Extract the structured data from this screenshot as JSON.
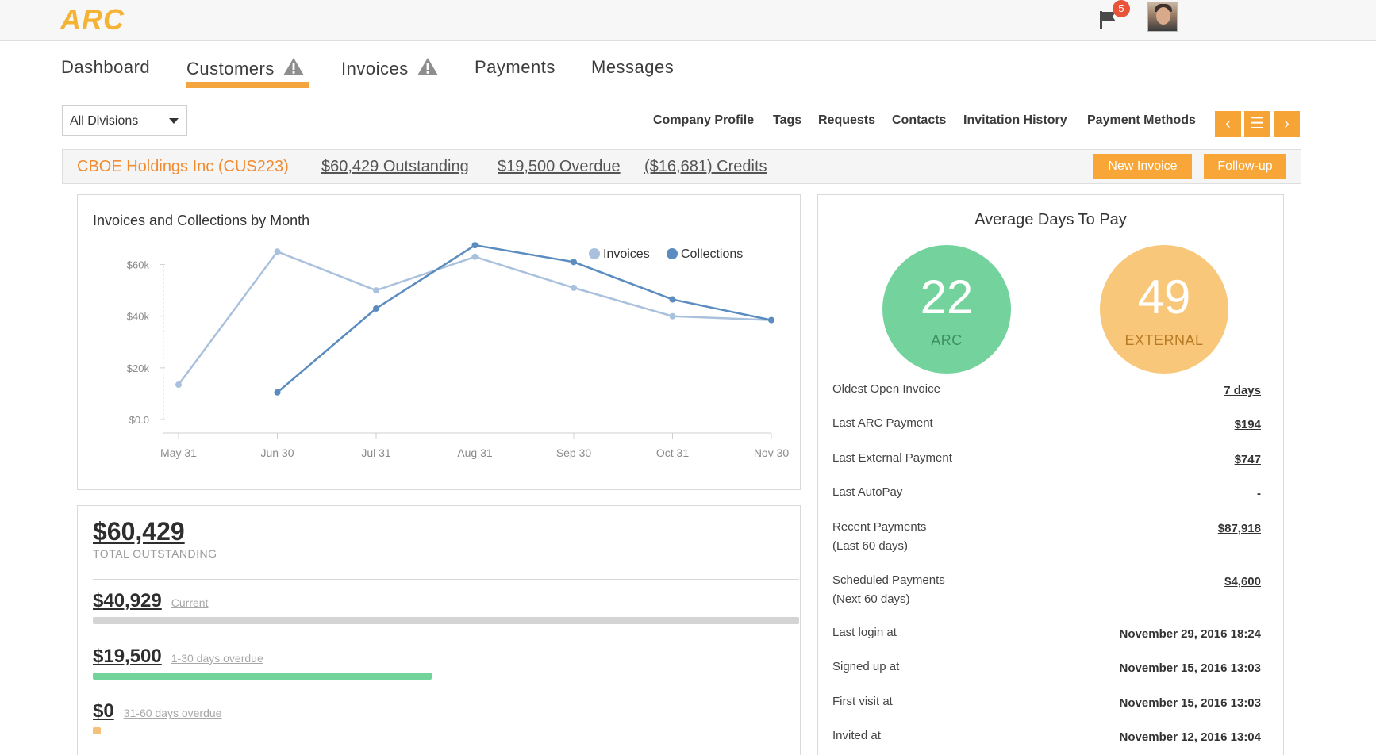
{
  "app": {
    "logo": "ARC",
    "notification_count": "5"
  },
  "nav": {
    "tabs": [
      {
        "label": "Dashboard",
        "warning": false,
        "active": false
      },
      {
        "label": "Customers",
        "warning": true,
        "active": true
      },
      {
        "label": "Invoices",
        "warning": true,
        "active": false
      },
      {
        "label": "Payments",
        "warning": false,
        "active": false
      },
      {
        "label": "Messages",
        "warning": false,
        "active": false
      }
    ]
  },
  "filter": {
    "division": "All Divisions"
  },
  "subnav": {
    "links": [
      "Company Profile",
      "Tags",
      "Requests",
      "Contacts",
      "Invitation History",
      "Payment Methods"
    ],
    "prev_icon": "‹",
    "list_icon": "☰",
    "next_icon": "›"
  },
  "customer": {
    "name": "CBOE Holdings Inc (CUS223)",
    "outstanding": "$60,429 Outstanding",
    "overdue": "$19,500 Overdue",
    "credits": "($16,681) Credits",
    "new_invoice_label": "New Invoice",
    "followup_label": "Follow-up"
  },
  "chart_data": {
    "type": "line",
    "title": "Invoices and Collections by Month",
    "categories": [
      "May 31",
      "Jun 30",
      "Jul 31",
      "Aug 31",
      "Sep 30",
      "Oct 31",
      "Nov 30"
    ],
    "yticks": [
      "$0.0",
      "$20k",
      "$40k",
      "$60k"
    ],
    "ylim": [
      0,
      70000
    ],
    "legend_position": "top-right",
    "series": [
      {
        "name": "Invoices",
        "color": "#a9c1dc",
        "values": [
          13500,
          65000,
          50000,
          63000,
          51000,
          40000,
          38500
        ]
      },
      {
        "name": "Collections",
        "color": "#5b8cc0",
        "values": [
          null,
          10500,
          43000,
          67500,
          61000,
          46500,
          38500
        ]
      }
    ]
  },
  "outstanding": {
    "total": "$60,429",
    "total_label": "TOTAL OUTSTANDING",
    "buckets": [
      {
        "amount": "$40,929",
        "label": "Current",
        "fraction": 1.0,
        "color": "#d4d4d4"
      },
      {
        "amount": "$19,500",
        "label": "1-30 days overdue",
        "fraction": 0.48,
        "color": "#72d39b"
      },
      {
        "amount": "$0",
        "label": "31-60 days overdue",
        "fraction": 0.0,
        "color": "#f5c07a"
      }
    ]
  },
  "days_to_pay": {
    "title": "Average Days To Pay",
    "arc": {
      "value": "22",
      "label": "ARC",
      "color": "#74d39c"
    },
    "external": {
      "value": "49",
      "label": "EXTERNAL",
      "color": "#f9c77a"
    },
    "stats": [
      {
        "label": "Oldest Open Invoice",
        "sublabel": "",
        "value": "7 days",
        "link": true
      },
      {
        "label": "Last ARC Payment",
        "sublabel": "",
        "value": "$194",
        "link": true
      },
      {
        "label": "Last External Payment",
        "sublabel": "",
        "value": "$747",
        "link": true
      },
      {
        "label": "Last AutoPay",
        "sublabel": "",
        "value": "-",
        "link": false
      },
      {
        "label": "Recent Payments",
        "sublabel": "(Last 60 days)",
        "value": "$87,918",
        "link": true
      },
      {
        "label": "Scheduled Payments",
        "sublabel": "(Next 60 days)",
        "value": "$4,600",
        "link": true
      },
      {
        "label": "Last login at",
        "sublabel": "",
        "value": "November 29, 2016 18:24",
        "link": false
      },
      {
        "label": "Signed up at",
        "sublabel": "",
        "value": "November 15, 2016 13:03",
        "link": false
      },
      {
        "label": "First visit at",
        "sublabel": "",
        "value": "November 15, 2016 13:03",
        "link": false
      },
      {
        "label": "Invited at",
        "sublabel": "",
        "value": "November 12, 2016 13:04",
        "link": false
      }
    ]
  }
}
